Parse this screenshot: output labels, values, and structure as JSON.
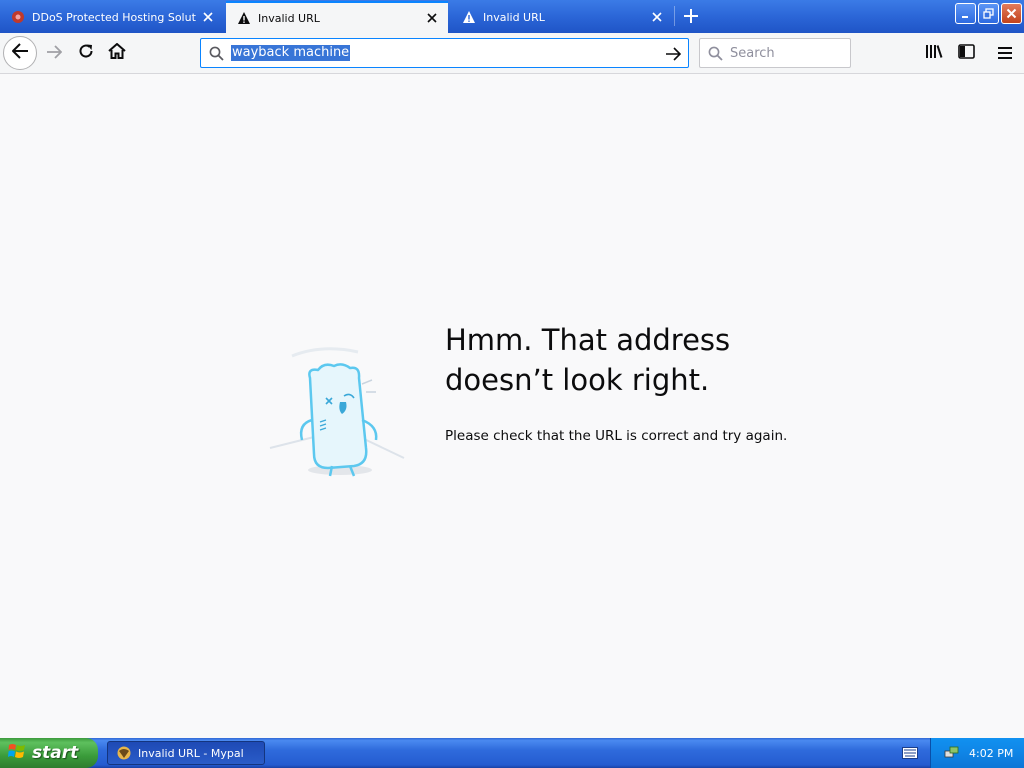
{
  "tabs": [
    {
      "label": "DDoS Protected Hosting Solutions",
      "icon": "site-favicon-icon",
      "active": false
    },
    {
      "label": "Invalid URL",
      "icon": "warning-icon",
      "active": true
    },
    {
      "label": "Invalid URL",
      "icon": "warning-icon",
      "active": false
    }
  ],
  "urlbar": {
    "value": "wayback machine"
  },
  "searchbar": {
    "placeholder": "Search"
  },
  "error": {
    "title_line1": "Hmm. That address",
    "title_line2": "doesn’t look right.",
    "description": "Please check that the URL is correct and try again."
  },
  "taskbar": {
    "start_label": "start",
    "task_item": "Invalid URL - Mypal",
    "clock": "4:02 PM"
  },
  "colors": {
    "accent": "#0a84ff",
    "selection": "#3875d7",
    "xp_blue": "#245bd0",
    "xp_green": "#3a9b3a",
    "page_bg": "#f9f9fa"
  }
}
